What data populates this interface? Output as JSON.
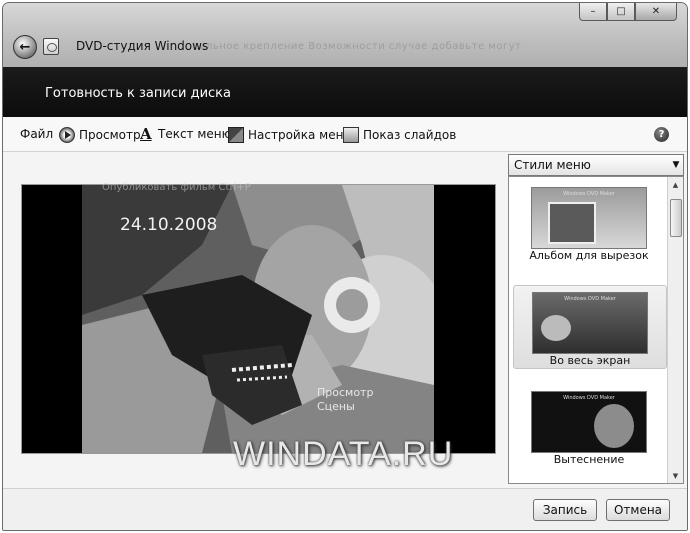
{
  "window": {
    "title": "DVD-студия Windows",
    "controls": {
      "minimize": "–",
      "maximize": "□",
      "close": "✕"
    },
    "background_text": [
      "сильное  крепление  Возможности  случае  добавьте  могут",
      "Опубликовать фильм                     Ctrl+P"
    ]
  },
  "header": {
    "title": "Готовность к записи диска"
  },
  "toolbar": {
    "file": "Файл",
    "preview": "Просмотр",
    "menu_text": "Текст меню",
    "menu_settings": "Настройка меню",
    "slideshow": "Показ слайдов",
    "help": "?"
  },
  "preview": {
    "date": "24.10.2008",
    "scene_preview_line1": "Просмотр",
    "scene_preview_line2": "Сцены"
  },
  "styles": {
    "dropdown_label": "Стили меню",
    "items": [
      {
        "label": "Альбом для вырезок",
        "thumb_title": "Windows DVD Maker",
        "selected": false
      },
      {
        "label": "Во весь экран",
        "thumb_title": "Windows DVD Maker",
        "selected": true
      },
      {
        "label": "Вытеснение",
        "thumb_title": "Windows DVD Maker",
        "selected": false
      }
    ]
  },
  "watermark": "WINDATA.RU",
  "footer": {
    "record": "Запись",
    "cancel": "Отмена"
  },
  "colors": {
    "header_bg": "#0c0c0c",
    "window_bg": "#f4f4f4"
  }
}
